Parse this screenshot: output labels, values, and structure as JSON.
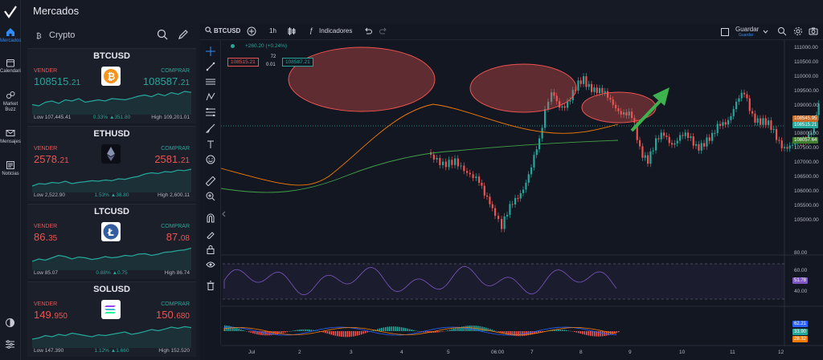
{
  "app": {
    "title": "Mercados"
  },
  "rail": {
    "items": [
      {
        "label": "Mercados"
      },
      {
        "label": "Calendario"
      },
      {
        "label": "Market Buzz"
      },
      {
        "label": "Mensajes"
      },
      {
        "label": "Noticias"
      }
    ]
  },
  "watchlist": {
    "category": "Crypto",
    "cards": [
      {
        "name": "BTCUSD",
        "sell_label": "VENDER",
        "buy_label": "COMPRAR",
        "sell_main": "108515.",
        "sell_small": "21",
        "buy_main": "108587.",
        "buy_small": "21",
        "low": "Low 107,445.41",
        "change": "0.33% ▲351.80",
        "high": "High 109,201.01",
        "price_color": "green",
        "spark": [
          0.35,
          0.3,
          0.45,
          0.5,
          0.4,
          0.55,
          0.5,
          0.6,
          0.45,
          0.5,
          0.55,
          0.5,
          0.6,
          0.58,
          0.55,
          0.62,
          0.7,
          0.75,
          0.68,
          0.8,
          0.72,
          0.85,
          0.78,
          0.9,
          0.86
        ]
      },
      {
        "name": "ETHUSD",
        "sell_label": "VENDER",
        "buy_label": "COMPRAR",
        "sell_main": "2578.",
        "sell_small": "21",
        "buy_main": "2581.",
        "buy_small": "21",
        "low": "Low 2,522.90",
        "change": "1.53% ▲38.80",
        "high": "High 2,600.11",
        "price_color": "red",
        "spark": [
          0.2,
          0.3,
          0.28,
          0.35,
          0.32,
          0.4,
          0.3,
          0.35,
          0.38,
          0.42,
          0.4,
          0.45,
          0.42,
          0.5,
          0.48,
          0.55,
          0.6,
          0.7,
          0.75,
          0.72,
          0.8,
          0.78,
          0.86,
          0.84,
          0.9
        ]
      },
      {
        "name": "LTCUSD",
        "sell_label": "VENDER",
        "buy_label": "COMPRAR",
        "sell_main": "86.",
        "sell_small": "35",
        "buy_main": "87.",
        "buy_small": "08",
        "low": "Low 85.07",
        "change": "0.88% ▲0.75",
        "high": "High 86.74",
        "price_color": "red",
        "spark": [
          0.3,
          0.4,
          0.35,
          0.45,
          0.55,
          0.5,
          0.4,
          0.48,
          0.45,
          0.38,
          0.42,
          0.5,
          0.45,
          0.48,
          0.55,
          0.52,
          0.6,
          0.62,
          0.55,
          0.6,
          0.68,
          0.7,
          0.75,
          0.78,
          0.85
        ]
      },
      {
        "name": "SOLUSD",
        "sell_label": "VENDER",
        "buy_label": "COMPRAR",
        "sell_main": "149.",
        "sell_small": "950",
        "buy_main": "150.",
        "buy_small": "680",
        "low": "Low 147.390",
        "change": "1.12% ▲1.660",
        "high": "High 152.520",
        "price_color": "red",
        "spark": [
          0.3,
          0.35,
          0.45,
          0.4,
          0.5,
          0.45,
          0.55,
          0.5,
          0.45,
          0.4,
          0.48,
          0.45,
          0.5,
          0.55,
          0.6,
          0.5,
          0.55,
          0.62,
          0.7,
          0.65,
          0.72,
          0.8,
          0.75,
          0.82,
          0.78
        ]
      }
    ]
  },
  "chart": {
    "symbol": "BTCUSD",
    "interval": "1h",
    "indicators_label": "Indicadores",
    "save_label": "Guardar",
    "save_sub": "Guardar",
    "legend_change": "+260.20 (+0.24%)",
    "sell_box": "108515.21",
    "spread_top": "72",
    "spread_bottom": "0.01",
    "buy_box": "108587.21",
    "price_ticks": [
      "111000.00",
      "110500.00",
      "110000.00",
      "109500.00",
      "109000.00",
      "108500.00",
      "108000.00",
      "107500.00",
      "107000.00",
      "106500.00",
      "106000.00",
      "105500.00",
      "105000.00"
    ],
    "price_tags": [
      {
        "text": "108545.95",
        "color": "#c76a28"
      },
      {
        "text": "108515.21",
        "color": "#26a69a"
      },
      {
        "text": "108057.64",
        "color": "#3f7d2f"
      }
    ],
    "rsi_ticks": [
      "80.00",
      "60.00",
      "40.00"
    ],
    "rsi_tag": "51.78",
    "macd_tags": [
      {
        "text": "62.21",
        "color": "#2962ff"
      },
      {
        "text": "33.90",
        "color": "#26a69a"
      },
      {
        "text": "28.32",
        "color": "#f57c00"
      }
    ],
    "time_ticks": [
      "Jul",
      "2",
      "3",
      "4",
      "5",
      "06:00",
      "7",
      "8",
      "9",
      "10",
      "11",
      "12"
    ]
  },
  "colors": {
    "accent": "#2f8cf6",
    "up": "#26a69a",
    "down": "#ef5350"
  }
}
